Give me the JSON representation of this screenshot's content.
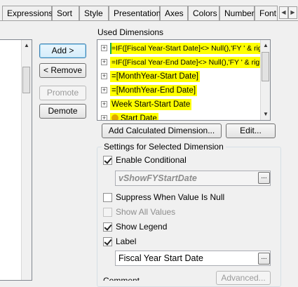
{
  "tabs": [
    "Expressions",
    "Sort",
    "Style",
    "Presentation",
    "Axes",
    "Colors",
    "Number",
    "Font"
  ],
  "tab_scroll_left": "◀",
  "tab_scroll_right": "▶",
  "buttons": {
    "add": "Add >",
    "remove": "< Remove",
    "promote": "Promote",
    "demote": "Demote",
    "add_calculated": "Add Calculated Dimension...",
    "edit": "Edit...",
    "advanced": "Advanced..."
  },
  "used_dimensions": {
    "title": "Used Dimensions",
    "items": [
      {
        "text": "=IF([Fiscal Year-Start Date]<> Null(),'FY ' & righ",
        "highlight": "green"
      },
      {
        "text": "=IF([Fiscal Year-End Date]<> Null(),'FY ' & righ",
        "highlight": "yellow"
      },
      {
        "text": "=[MonthYear-Start Date]",
        "highlight": "yellow"
      },
      {
        "text": "=[MonthYear-End Date]",
        "highlight": "yellow"
      },
      {
        "text": "Week Start-Start Date",
        "highlight": "yellow"
      },
      {
        "text": "Start Date",
        "highlight": "yellow"
      }
    ]
  },
  "settings": {
    "title": "Settings for Selected Dimension",
    "enable_conditional": {
      "label": "Enable Conditional",
      "checked": true
    },
    "conditional_value": "vShowFYStartDate",
    "suppress_null": {
      "label": "Suppress When Value Is Null",
      "checked": false
    },
    "show_all_values": {
      "label": "Show All Values",
      "checked": false
    },
    "show_legend": {
      "label": "Show Legend",
      "checked": true
    },
    "label": {
      "label": "Label",
      "checked": true
    },
    "label_value": "Fiscal Year Start Date",
    "ellipsis": "...",
    "comment_label": "Comment"
  },
  "colors": {
    "highlight_yellow": "#ffff00",
    "highlight_green": "#19a94a",
    "accent": "#3c7fb1"
  }
}
